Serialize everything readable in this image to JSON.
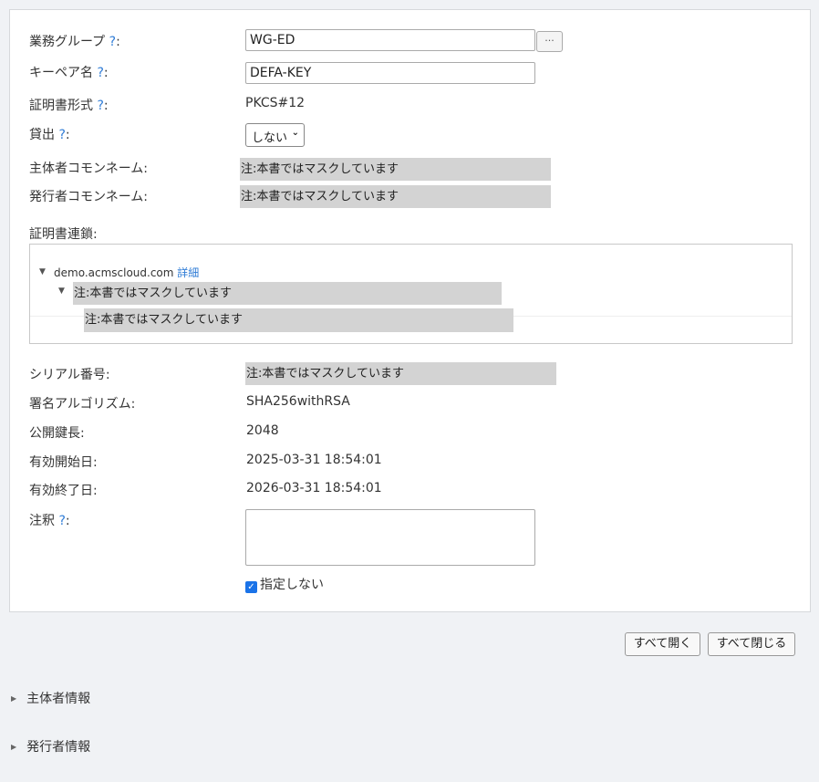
{
  "form": {
    "group": {
      "label": "業務グループ",
      "help": "?",
      "colon": ":",
      "value": "WG-ED",
      "picker": "···"
    },
    "keypair": {
      "label": "キーペア名",
      "help": "?",
      "colon": ":",
      "value": "DEFA-KEY"
    },
    "format": {
      "label": "証明書形式",
      "help": "?",
      "colon": ":",
      "value": "PKCS#12"
    },
    "lending": {
      "label": "貸出",
      "help": "?",
      "colon": ":",
      "value": "しない",
      "chevron": "⌄"
    },
    "subject_cn": {
      "label": "主体者コモンネーム:",
      "value": "注:本書ではマスクしています"
    },
    "issuer_cn": {
      "label": "発行者コモンネーム:",
      "value": "注:本書ではマスクしています"
    },
    "chain": {
      "label": "証明書連鎖:",
      "root": {
        "text": "demo.acmscloud.com",
        "link": "詳細"
      },
      "level2": "注:本書ではマスクしています",
      "level3": "注:本書ではマスクしています"
    },
    "serial": {
      "label": "シリアル番号:",
      "value": "注:本書ではマスクしています"
    },
    "algorithm": {
      "label": "署名アルゴリズム:",
      "value": "SHA256withRSA"
    },
    "key_length": {
      "label": "公開鍵長:",
      "value": "2048"
    },
    "valid_from": {
      "label": "有効開始日:",
      "value": "2025-03-31 18:54:01"
    },
    "valid_to": {
      "label": "有効終了日:",
      "value": "2026-03-31 18:54:01"
    },
    "note": {
      "label": "注釈",
      "help": "?",
      "colon": ":",
      "value": "",
      "no_spec_label": "指定しない",
      "no_spec_checked": true
    }
  },
  "buttons": {
    "expand_all": "すべて開く",
    "collapse_all": "すべて閉じる"
  },
  "sections": [
    {
      "label": "主体者情報"
    },
    {
      "label": "発行者情報"
    }
  ],
  "icons": {
    "expand": "triangle-down",
    "collapsed": "triangle-right",
    "check": "checkmark"
  }
}
